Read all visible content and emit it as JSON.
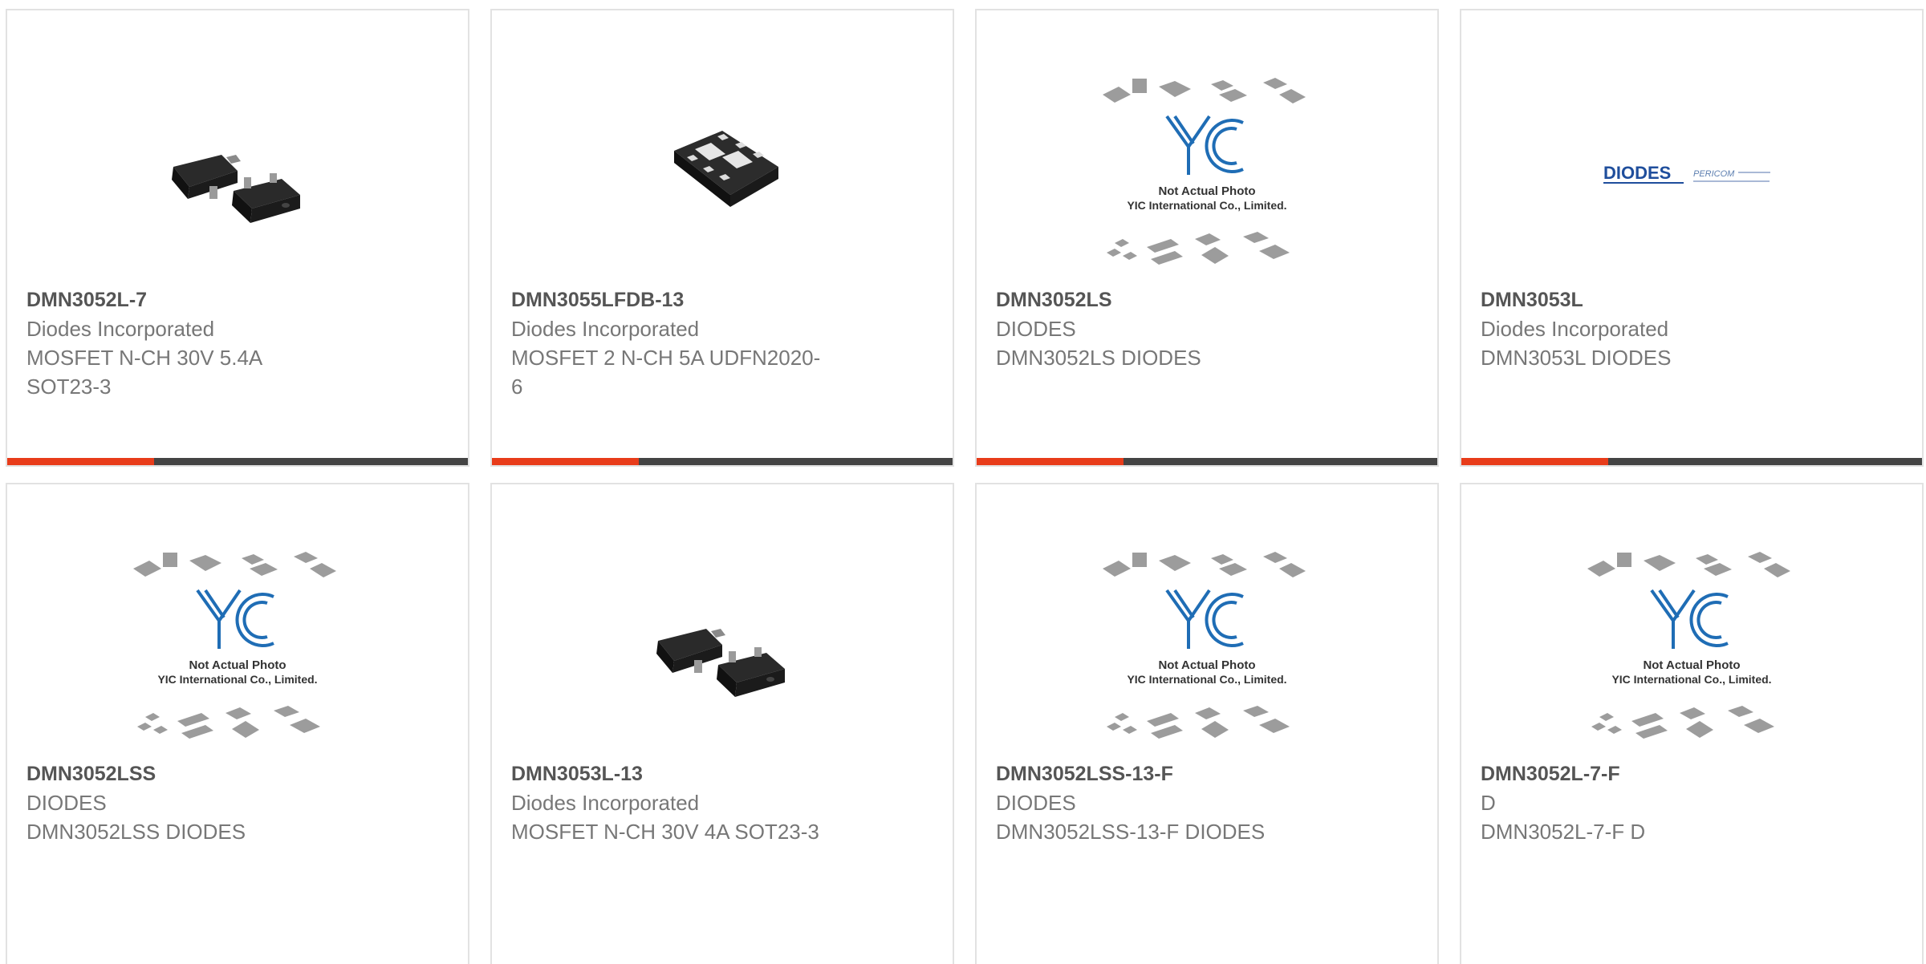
{
  "colors": {
    "accent": "#e83c1a",
    "bar_base": "#444444"
  },
  "products": [
    {
      "part_number": "DMN3052L-7",
      "manufacturer": "Diodes Incorporated",
      "description": "MOSFET N-CH 30V 5.4A\nSOT23-3",
      "image": "sot23-package-photo"
    },
    {
      "part_number": "DMN3055LFDB-13",
      "manufacturer": "Diodes Incorporated",
      "description": "MOSFET 2 N-CH 5A UDFN2020-\n6",
      "image": "udfn-package-photo"
    },
    {
      "part_number": "DMN3052LS",
      "manufacturer": "DIODES",
      "description": "DMN3052LS DIODES",
      "image": "yic-placeholder"
    },
    {
      "part_number": "DMN3053L",
      "manufacturer": "Diodes Incorporated",
      "description": "DMN3053L DIODES",
      "image": "diodes-pericom-logo"
    },
    {
      "part_number": "DMN3052LSS",
      "manufacturer": "DIODES",
      "description": "DMN3052LSS DIODES",
      "image": "yic-placeholder"
    },
    {
      "part_number": "DMN3053L-13",
      "manufacturer": "Diodes Incorporated",
      "description": "MOSFET N-CH 30V 4A SOT23-3",
      "image": "sot23-package-photo"
    },
    {
      "part_number": "DMN3052LSS-13-F",
      "manufacturer": "DIODES",
      "description": "DMN3052LSS-13-F DIODES",
      "image": "yic-placeholder"
    },
    {
      "part_number": "DMN3052L-7-F",
      "manufacturer": "D",
      "description": "DMN3052L-7-F D",
      "image": "yic-placeholder"
    }
  ],
  "placeholder": {
    "line1": "Not Actual Photo",
    "line2": "YIC International Co., Limited."
  },
  "logo": {
    "brand": "DIODES",
    "partner": "PERICOM"
  }
}
